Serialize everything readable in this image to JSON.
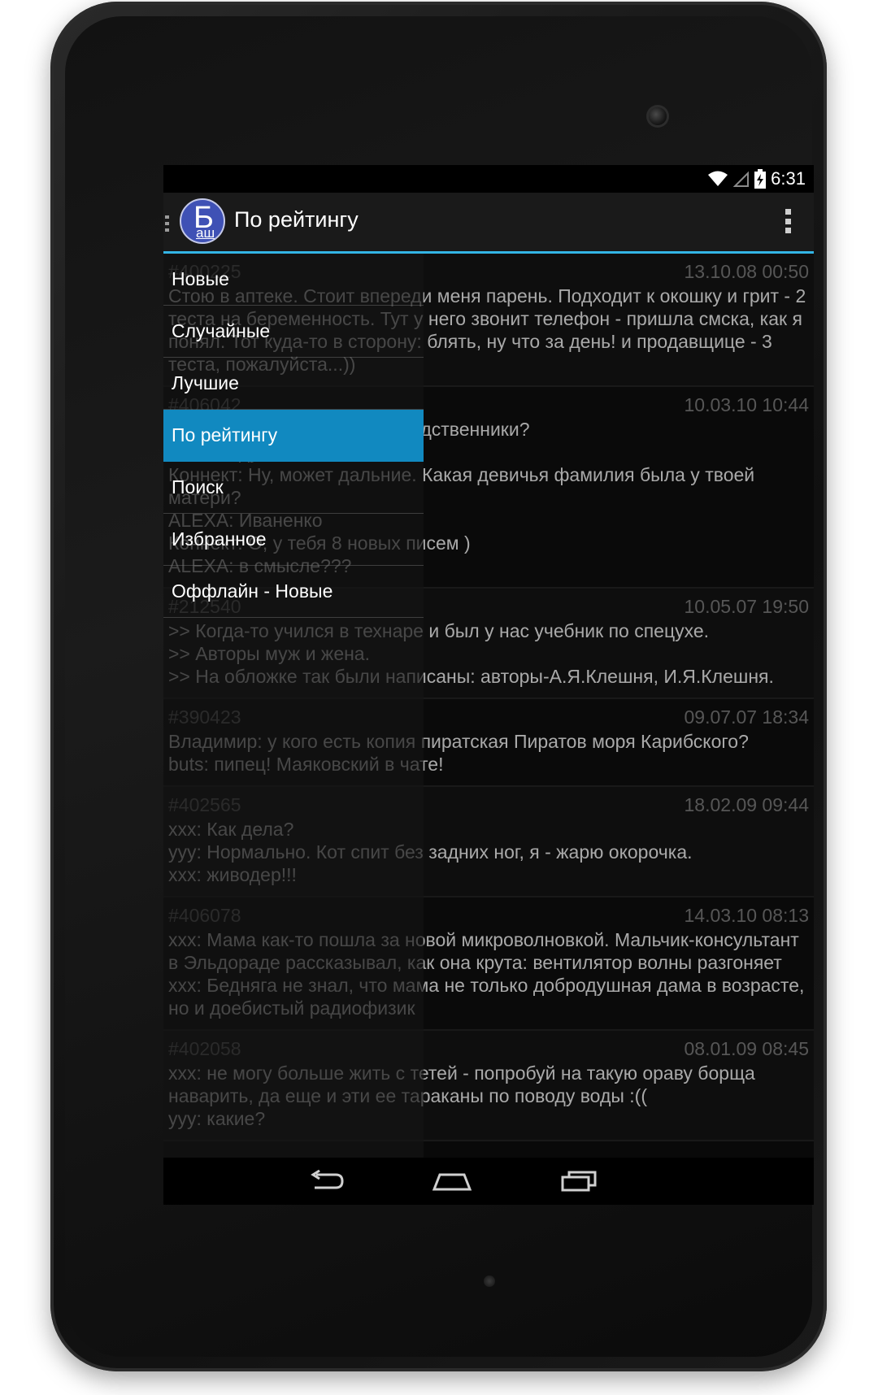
{
  "status_bar": {
    "time": "6:31",
    "icons": [
      "wifi-icon",
      "no-signal-icon",
      "battery-charging-icon"
    ]
  },
  "action_bar": {
    "logo_big": "Б",
    "logo_small": "аш",
    "title": "По рейтингу",
    "overflow_icon": "overflow-menu-icon",
    "accent_color": "#33b5e5"
  },
  "drawer": {
    "items": [
      {
        "label": "Новые"
      },
      {
        "label": "Случайные"
      },
      {
        "label": "Лучшие"
      },
      {
        "label": "По рейтингу",
        "selected": true
      },
      {
        "label": "Поиск"
      },
      {
        "label": "Избранное"
      },
      {
        "label": "Оффлайн - Новые"
      }
    ],
    "selected_color": "#1189c0"
  },
  "quotes": [
    {
      "id": "#400225",
      "date": "13.10.08 00:50",
      "text": "Стою в аптеке. Стоит впереди меня парень. Подходит к окошку и грит - 2 теста на беременность. Тут у него звонит телефон - пришла смска, как я понял. Тот куда-то в сторону: блять, ну что за день! и продавщице - 3 теста, пожалуйста...))"
    },
    {
      "id": "#406042",
      "date": "10.03.10 10:44",
      "text": "Коннект: Слушай, мож мы родственники?\nALEXA: думаешь???\nКоннект: Ну, может дальние. Какая девичья фамилия была у твоей матери?\nALEXA: Иваненко\nКоннект: О, у тебя 8 новых писем )\nALEXA: в смысле???"
    },
    {
      "id": "#212540",
      "date": "10.05.07 19:50",
      "text": ">> Когда-то учился в технаре и был у нас учебник по спецухе.\n>> Авторы муж и жена.\n>> На обложке так были написаны: авторы-А.Я.Клешня, И.Я.Клешня."
    },
    {
      "id": "#390423",
      "date": "09.07.07 18:34",
      "text": "Владимир: у кого есть копия пиратская Пиратов моря Карибского?\nbuts: пипец! Маяковский в чате!"
    },
    {
      "id": "#402565",
      "date": "18.02.09 09:44",
      "text": "ххх: Как дела?\nууу: Нормально. Кот спит без задних ног, я - жарю окорочка.\nххх: живодер!!!"
    },
    {
      "id": "#406078",
      "date": "14.03.10 08:13",
      "text": "ххх: Мама как-то пошла за новой микроволновкой. Мальчик-консультант в Эльдораде рассказывал, как она крута: вентилятор волны разгоняет\nххх: Бедняга не знал, что мама не только добродушная дама в возрасте, но и доебистый радиофизик"
    },
    {
      "id": "#402058",
      "date": "08.01.09 08:45",
      "text": "ххх: не могу больше жить с тетей - попробуй на такую ораву борща наварить, да еще и эти ее тараканы по поводу воды :((\nууу: какие?"
    }
  ],
  "nav_bar": {
    "back_icon": "back-icon",
    "home_icon": "home-icon",
    "recents_icon": "recent-apps-icon"
  }
}
